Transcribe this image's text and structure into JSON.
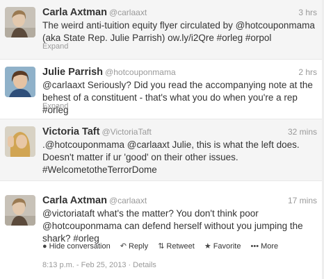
{
  "tweets": [
    {
      "fullname": "Carla Axtman",
      "username": "@carlaaxt",
      "time": "3 hrs",
      "text": "The weird anti-tuition equity flyer circulated by @hotcouponmama (aka State Rep. Julie Parrish) ow.ly/i2Qre #orleg #orpol",
      "expand": "Expand"
    },
    {
      "fullname": "Julie Parrish",
      "username": "@hotcouponmama",
      "time": "2 hrs",
      "text": "@carlaaxt Seriously? Did you read the accompanying note at the behest of a constituent - that's what you do when you're a rep #orleg",
      "expand": "Expand"
    },
    {
      "fullname": "Victoria Taft",
      "username": "@VictoriaTaft",
      "time": "32 mins",
      "text": ".@hotcouponmama @carlaaxt Julie, this is what the left does. Doesn't matter if ur 'good' on their other issues. #WelcometotheTerrorDome"
    },
    {
      "fullname": "Carla Axtman",
      "username": "@carlaaxt",
      "time": "17 mins",
      "text": "@victoriataft what's the matter? You don't think poor @hotcouponmama can defend herself without you jumping the shark? #orleg",
      "actions": {
        "hide": "Hide conversation",
        "reply": "Reply",
        "retweet": "Retweet",
        "favorite": "Favorite",
        "more": "More"
      },
      "timestamp": "8:13 p.m. - Feb 25, 2013",
      "separator": "·",
      "details": "Details"
    }
  ],
  "icons": {
    "hide": "conversation-icon",
    "reply": "reply-icon",
    "retweet": "retweet-icon",
    "favorite": "star-icon",
    "more": "more-dots-icon"
  },
  "colors": {
    "name": "#333333",
    "muted": "#999999",
    "row_alt": "#f5f5f5"
  }
}
